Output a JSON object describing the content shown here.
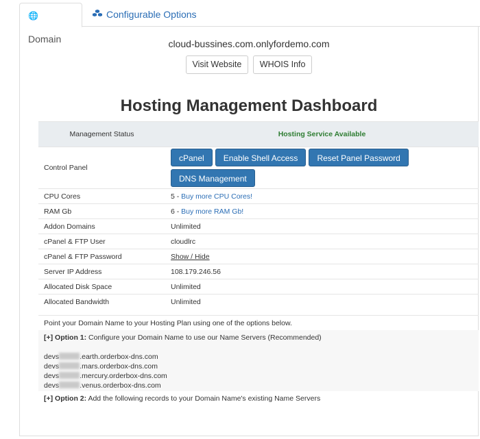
{
  "tabs": [
    {
      "label": "Domain",
      "icon": "globe-icon",
      "active": true
    },
    {
      "label": "Configurable Options",
      "icon": "cubes-icon",
      "active": false
    }
  ],
  "domain": "cloud-bussines.com.onlyfordemo.com",
  "top_buttons": {
    "visit": "Visit Website",
    "whois": "WHOIS Info"
  },
  "dashboard": {
    "title": "Hosting Management Dashboard",
    "status_label": "Management Status",
    "status_value": "Hosting Service Available",
    "control_panel_label": "Control Panel",
    "cp_buttons": [
      "cPanel",
      "Enable Shell Access",
      "Reset Panel Password",
      "DNS Management"
    ],
    "rows": [
      {
        "label": "CPU Cores",
        "value": "5 - ",
        "link": "Buy more CPU Cores!"
      },
      {
        "label": "RAM Gb",
        "value": "6 - ",
        "link": "Buy more RAM Gb!"
      },
      {
        "label": "Addon Domains",
        "value": "Unlimited"
      },
      {
        "label": "cPanel & FTP User",
        "value": "cloudlrc"
      },
      {
        "label": "cPanel & FTP Password",
        "value": "Show / Hide"
      },
      {
        "label": "Server IP Address",
        "value": "108.179.246.56"
      },
      {
        "label": "Allocated Disk Space",
        "value": "Unlimited"
      },
      {
        "label": "Allocated Bandwidth",
        "value": "Unlimited"
      }
    ]
  },
  "instructions": {
    "intro": "Point your Domain Name to your Hosting Plan using one of the options below.",
    "option1_prefix": "[+] Option 1:",
    "option1_text": " Configure your Domain Name to use our Name Servers (Recommended)",
    "ns_prefix": "devs",
    "name_servers": [
      ".earth.orderbox-dns.com",
      ".mars.orderbox-dns.com",
      ".mercury.orderbox-dns.com",
      ".venus.orderbox-dns.com"
    ],
    "option2_prefix": "[+] Option 2:",
    "option2_text": " Add the following records to your Domain Name's existing Name Servers"
  },
  "colors": {
    "primary": "#3276b1",
    "link": "#2a6db5",
    "success": "#2e7d32",
    "header_bg": "#e9edf0"
  }
}
